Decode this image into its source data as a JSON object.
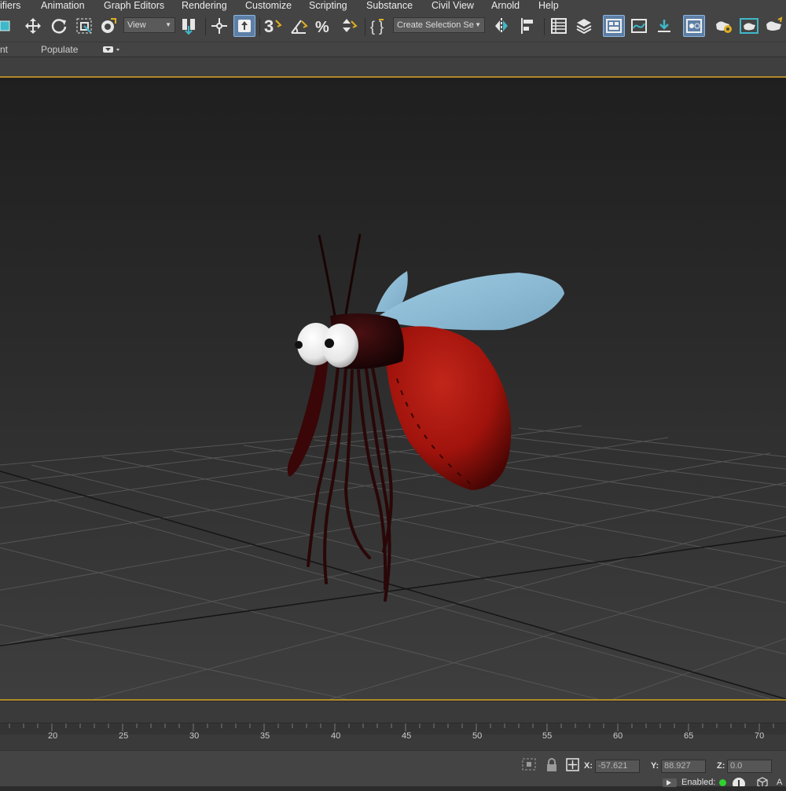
{
  "menu": {
    "items": [
      "ifiers",
      "Animation",
      "Graph Editors",
      "Rendering",
      "Customize",
      "Scripting",
      "Substance",
      "Civil View",
      "Arnold",
      "Help"
    ]
  },
  "toolbar": {
    "view_dropdown": "View",
    "selection_set_dropdown": "Create Selection Se",
    "icons": [
      "select-icon",
      "move-icon",
      "rotate-icon",
      "scale-icon",
      "placement-icon",
      "pivot-icon",
      "transform-icon",
      "manipulate-icon",
      "snap-3d-icon",
      "angle-snap-icon",
      "percent-snap-icon",
      "spinner-snap-icon",
      "edit-selection-set-icon",
      "mirror-icon",
      "align-icon",
      "scene-explorer-icon",
      "layer-explorer-icon",
      "ribbon-toggle-icon",
      "curve-editor-icon",
      "schematic-view-icon",
      "material-editor-icon",
      "render-setup-icon",
      "render-frame-icon",
      "render-icon"
    ]
  },
  "ribbon": {
    "left_text": "nt",
    "populate_label": "Populate"
  },
  "timeline": {
    "ticks": [
      "20",
      "25",
      "30",
      "35",
      "40",
      "45",
      "50",
      "55",
      "60",
      "65",
      "70"
    ]
  },
  "status": {
    "x_label": "X:",
    "x_value": "-57.621",
    "y_label": "Y:",
    "y_value": "88.927",
    "z_label": "Z:",
    "z_value": "0.0",
    "enabled_label": "Enabled:",
    "trailing_text": "A"
  },
  "colors": {
    "accent": "#5d7fa6",
    "viewport_border": "#b08a2a",
    "body_red": "#a0130c",
    "wing_blue": "#8ab8d4",
    "enabled_green": "#2fd12f"
  }
}
